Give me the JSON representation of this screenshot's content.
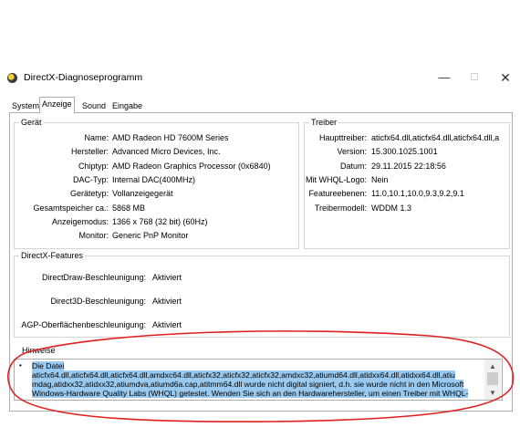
{
  "window": {
    "title": "DirectX-Diagnoseprogramm",
    "min_glyph": "—",
    "max_glyph": "☐",
    "close_glyph": "✕"
  },
  "tabs": [
    {
      "label": "System"
    },
    {
      "label": "Anzeige",
      "active": true
    },
    {
      "label": "Sound"
    },
    {
      "label": "Eingabe"
    }
  ],
  "geraet": {
    "legend": "Gerät",
    "rows": [
      {
        "label": "Name:",
        "value": "AMD Radeon HD 7600M Series"
      },
      {
        "label": "Hersteller:",
        "value": "Advanced Micro Devices, Inc."
      },
      {
        "label": "Chiptyp:",
        "value": "AMD Radeon Graphics Processor (0x6840)"
      },
      {
        "label": "DAC-Typ:",
        "value": "Internal DAC(400MHz)"
      },
      {
        "label": "Gerätetyp:",
        "value": "Vollanzeigegerät"
      },
      {
        "label": "Gesamtspeicher ca.:",
        "value": "5868 MB"
      },
      {
        "label": "Anzeigemodus:",
        "value": "1366 x 768 (32 bit) (60Hz)"
      },
      {
        "label": "Monitor:",
        "value": "Generic PnP Monitor"
      }
    ]
  },
  "treiber": {
    "legend": "Treiber",
    "rows": [
      {
        "label": "Haupttreiber:",
        "value": "aticfx64.dll,aticfx64.dll,aticfx64.dll,a"
      },
      {
        "label": "Version:",
        "value": "15.300.1025.1001"
      },
      {
        "label": "Datum:",
        "value": "29.11.2015 22:18:56"
      },
      {
        "label": "Mit WHQL-Logo:",
        "value": "Nein"
      },
      {
        "label": "Featureebenen:",
        "value": "11.0,10.1,10.0,9.3,9.2,9.1"
      },
      {
        "label": "Treibermodell:",
        "value": "WDDM 1.3"
      }
    ]
  },
  "features": {
    "legend": "DirectX-Features",
    "rows": [
      {
        "label": "DirectDraw-Beschleunigung:",
        "value": "Aktiviert"
      },
      {
        "label": "Direct3D-Beschleunigung:",
        "value": "Aktiviert"
      },
      {
        "label": "AGP-Oberflächenbeschleunigung:",
        "value": "Aktiviert"
      }
    ]
  },
  "hinweise": {
    "legend": "Hinweise",
    "bullet": "•",
    "lines": [
      "Die Datei",
      "aticfx64.dll,aticfx64.dll,aticfx64.dll,amdxc64.dll,aticfx32,aticfx32,aticfx32,amdxc32,atiumd64.dll,atidxx64.dll,atidxx64.dll,atiu",
      "mdag,atidxx32,atidxx32,atiumdva,atiumd6a.cap,atitmm64.dll wurde nicht digital signiert, d.h. sie wurde nicht in den Microsoft",
      "Windows-Hardware Quality Labs (WHQL) getestet. Wenden Sie sich an den Hardwarehersteller, um einen Treiber mit WHQL-"
    ]
  },
  "colors": {
    "selection": "#99c9ef",
    "annotation": "#e02020"
  }
}
